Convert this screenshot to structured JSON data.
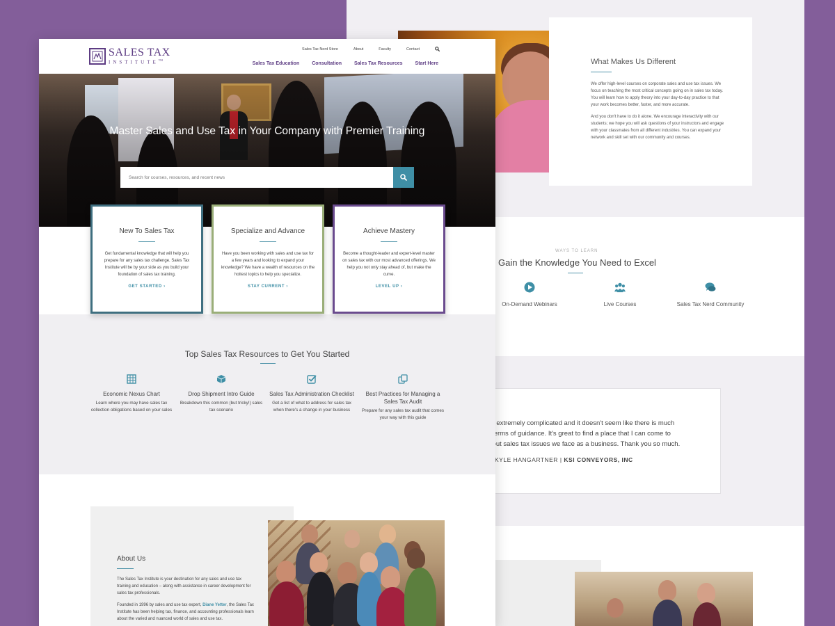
{
  "back_page": {
    "about_card": {
      "title": "What Makes Us Different",
      "p1": "We offer high-level courses on corporate sales and use tax issues. We focus on teaching the most critical concepts going on in sales tax today. You will learn how to apply theory into your day-to-day practice to that your work becomes better, faster, and more accurate.",
      "p2": "And you don't have to do it alone. We encourage interactivity with our students; we hope you will ask questions of your instructors and engage with your classmates from all different industries. You can expand your network and skill set with our community and courses."
    },
    "ways": {
      "kicker": "WAYS TO LEARN",
      "title": "Gain the Knowledge You Need to Excel",
      "items": [
        {
          "label": "On-Demand Webinars",
          "icon": "play-circle-icon"
        },
        {
          "label": "Live Courses",
          "icon": "users-icon"
        },
        {
          "label": "Sales Tax Nerd Community",
          "icon": "chat-bubbles-icon"
        }
      ]
    },
    "testimonial": {
      "line1": "are extremely complicated and it doesn't seem like there is much",
      "line2": "in terms of guidance. It's great to find a place that I can come to",
      "line3": "about sales tax issues we face as a business. Thank you so much.",
      "name": "KYLE HANGARTNER",
      "separator": "|",
      "company": "KSI CONVEYORS, INC"
    }
  },
  "header": {
    "logo_line1": "SALES TAX",
    "logo_line2": "INSTITUTE",
    "logo_tm": "TM",
    "top_nav": [
      "Sales Tax Nerd Store",
      "About",
      "Faculty",
      "Contact"
    ],
    "main_nav": [
      "Sales Tax Education",
      "Consultation",
      "Sales Tax Resources",
      "Start Here"
    ]
  },
  "hero": {
    "headline": "Master Sales and Use Tax in Your Company with Premier Training",
    "search_placeholder": "Search for courses, resources, and recent news"
  },
  "cards": [
    {
      "title": "New To Sales Tax",
      "body": "Get fundamental knowledge that will help you prepare for any sales tax challenge. Sales Tax Institute will be by your side as you build your foundation of sales tax training.",
      "cta": "GET STARTED  ›"
    },
    {
      "title": "Specialize and Advance",
      "body": "Have you been working with sales and use tax for a few years and looking to expand your knowledge? We have a wealth of resources on the hottest topics to help you specialize.",
      "cta": "STAY CURRENT  ›"
    },
    {
      "title": "Achieve Mastery",
      "body": "Become a thought-leader and expert-level master on sales tax with our most advanced offerings. We help you not only stay ahead of, but make the curve.",
      "cta": "LEVEL UP  ›"
    }
  ],
  "resources": {
    "title": "Top Sales Tax Resources to Get You Started",
    "items": [
      {
        "title": "Economic Nexus Chart",
        "body": "Learn where you may have sales tax collection obligations based on your sales",
        "icon": "table-icon"
      },
      {
        "title": "Drop Shipment Intro Guide",
        "body": "Breakdown this common (but tricky!) sales tax scenario",
        "icon": "box-icon"
      },
      {
        "title": "Sales Tax Administration Checklist",
        "body": "Get a list of what to address for sales tax when there's a change in your business",
        "icon": "checkbox-icon"
      },
      {
        "title": "Best Practices for Managing a Sales Tax Audit",
        "body": "Prepare for any sales tax audit that comes your way with this guide",
        "icon": "copy-icon"
      }
    ]
  },
  "about": {
    "title": "About Us",
    "p1": "The Sales Tax Institute is your destination for any sales and use tax training and education – along with assistance in career development for sales tax professionals.",
    "p2_pre": "Founded in 1996 by sales and use tax expert,",
    "p2_link": "Diane Yetter",
    "p2_post": ", the Sales Tax Institute has been helping tax, finance, and accounting professionals learn about the varied and nuanced world of sales and use tax."
  },
  "colors": {
    "purple": "#5d3c83",
    "teal": "#3f8fa6",
    "background": "#835e9a"
  }
}
